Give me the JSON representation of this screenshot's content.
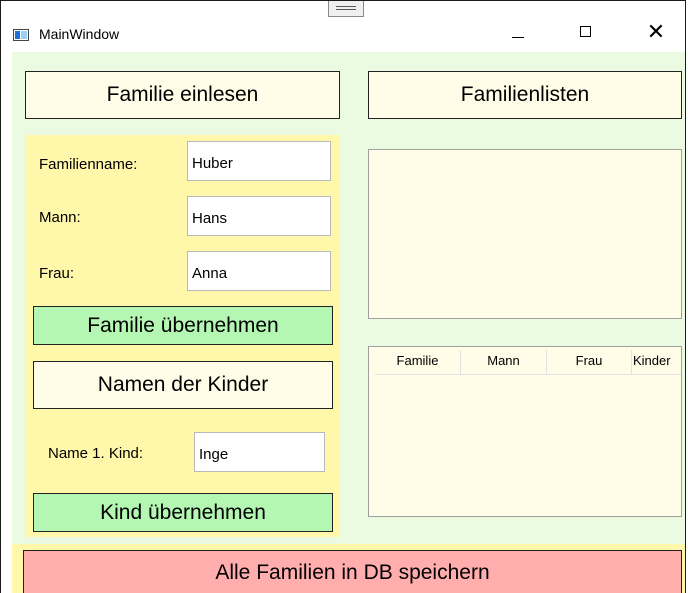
{
  "window": {
    "title": "MainWindow",
    "controls": {
      "minimize": "",
      "maximize": "",
      "close": "✕"
    }
  },
  "buttons": {
    "familie_einlesen": "Familie einlesen",
    "familienlisten": "Familienlisten",
    "familie_uebernehmen": "Familie übernehmen",
    "namen_der_kinder": "Namen der Kinder",
    "kind_uebernehmen": "Kind übernehmen",
    "alle_familien_speichern": "Alle Familien in DB speichern"
  },
  "form": {
    "familienname_label": "Familienname:",
    "familienname_value": "Huber",
    "mann_label": "Mann:",
    "mann_value": "Hans",
    "frau_label": "Frau:",
    "frau_value": "Anna",
    "kind_label": "Name 1. Kind:",
    "kind_value": "Inge"
  },
  "listview": {
    "columns": [
      "Familie",
      "Mann",
      "Frau",
      "Kinder"
    ],
    "rows": []
  },
  "colors": {
    "content_bg": "#eafbe2",
    "panel_bg": "#fff7a9",
    "ivory": "#fffde8",
    "green_button": "#b3f7b3",
    "red_button": "#ffadad"
  },
  "icons": {
    "app": "app-window-icon",
    "grip": "drag-grip-icon"
  }
}
